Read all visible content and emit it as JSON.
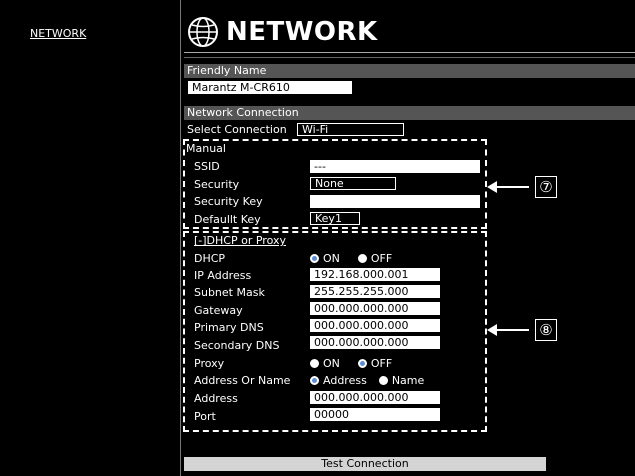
{
  "sidebar": {
    "network_link": "NETWORK"
  },
  "header": {
    "title": "NETWORK",
    "icon": "globe-icon"
  },
  "friendly_name": {
    "section": "Friendly Name",
    "value": "Marantz M-CR610"
  },
  "network_connection": {
    "section": "Network Connection",
    "select_label": "Select Connection",
    "select_value": "Wi-Fi"
  },
  "manual": {
    "heading": "Manual",
    "ssid_label": "SSID",
    "ssid_value": "---",
    "security_label": "Security",
    "security_value": "None",
    "security_key_label": "Security Key",
    "security_key_value": "",
    "default_key_label": "Defaullt Key",
    "default_key_value": "Key1",
    "callout": "⑦"
  },
  "dhcp": {
    "heading": "[-]DHCP or Proxy",
    "dhcp_label": "DHCP",
    "dhcp_on": "ON",
    "dhcp_off": "OFF",
    "dhcp_selected": "ON",
    "ip_label": "IP Address",
    "ip_value": "192.168.000.001",
    "subnet_label": "Subnet Mask",
    "subnet_value": "255.255.255.000",
    "gateway_label": "Gateway",
    "gateway_value": "000.000.000.000",
    "pdns_label": "Primary DNS",
    "pdns_value": "000.000.000.000",
    "sdns_label": "Secondary DNS",
    "sdns_value": "000.000.000.000",
    "proxy_label": "Proxy",
    "proxy_on": "ON",
    "proxy_off": "OFF",
    "proxy_selected": "OFF",
    "addr_or_name_label": "Address Or Name",
    "addr_opt": "Address",
    "name_opt": "Name",
    "addr_or_name_selected": "Address",
    "address_label": "Address",
    "address_value": "000.000.000.000",
    "port_label": "Port",
    "port_value": "00000",
    "callout": "⑧"
  },
  "footer": {
    "test_button": "Test Connection"
  },
  "colors": {
    "section_bar": "#555555",
    "radio_selected": "#5a8fd8",
    "button": "#d4d4d4"
  }
}
